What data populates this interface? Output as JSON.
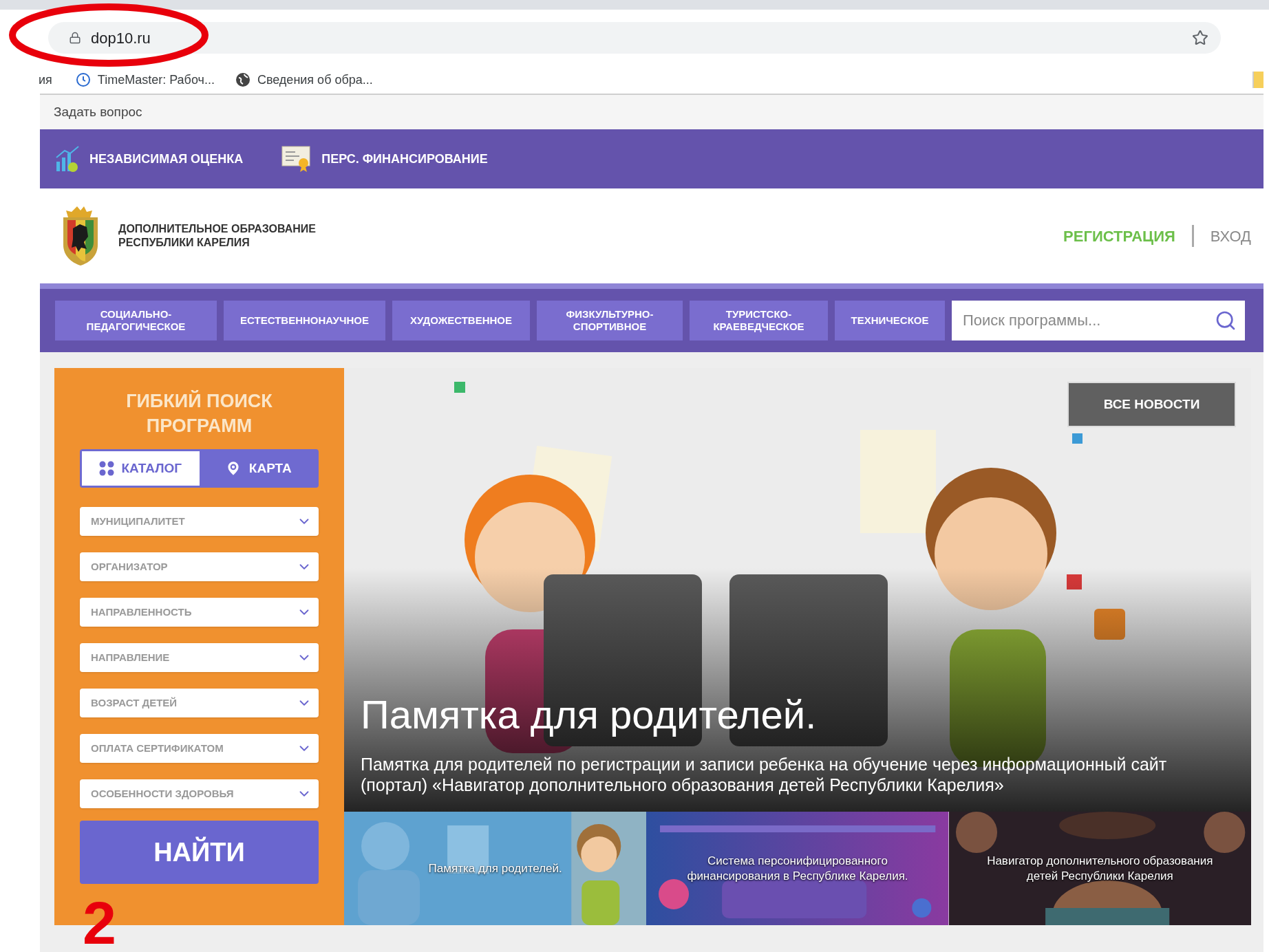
{
  "browser": {
    "address": "dop10.ru",
    "bookmarks": [
      "ия",
      "TimeMaster: Рабоч...",
      "Сведения об обра..."
    ]
  },
  "annotations": [
    {
      "kind": "ellipse"
    },
    {
      "kind": "digit",
      "text": "2"
    }
  ],
  "top_link": "Задать вопрос",
  "promo_bar": [
    "НЕЗАВИСИМАЯ ОЦЕНКА",
    "ПЕРС. ФИНАНСИРОВАНИЕ"
  ],
  "site": {
    "title": "ДОПОЛНИТЕЛЬНОЕ ОБРАЗОВАНИЕ РЕСПУБЛИКИ КАРЕЛИЯ",
    "register": "РЕГИСТРАЦИЯ",
    "login": "ВХОД"
  },
  "nav": [
    "СОЦИАЛЬНО-ПЕДАГОГИЧЕСКОЕ",
    "ЕСТЕСТВЕННОНАУЧНОЕ",
    "ХУДОЖЕСТВЕННОЕ",
    "ФИЗКУЛЬТУРНО-СПОРТИВНОЕ",
    "ТУРИСТСКО-КРАЕВЕДЧЕСКОЕ",
    "ТЕХНИЧЕСКОЕ"
  ],
  "search": {
    "placeholder": "Поиск программы..."
  },
  "sidebar": {
    "title": "ГИБКИЙ ПОИСК ПРОГРАММ",
    "view_tabs": [
      {
        "label": "КАТАЛОГ",
        "selected": true
      },
      {
        "label": "КАРТА",
        "selected": false
      }
    ],
    "filters": [
      "МУНИЦИПАЛИТЕТ",
      "ОРГАНИЗАТОР",
      "НАПРАВЛЕННОСТЬ",
      "НАПРАВЛЕНИЕ",
      "ВОЗРАСТ ДЕТЕЙ",
      "ОПЛАТА СЕРТИФИКАТОМ",
      "ОСОБЕННОСТИ ЗДОРОВЬЯ"
    ],
    "submit": "НАЙТИ"
  },
  "banner": {
    "button": "ВСЕ НОВОСТИ",
    "title": "Памятка для родителей.",
    "text": "Памятка для родителей по регистрации и записи ребенка на обучение через информационный сайт (портал) «Навигатор дополнительного образования детей Республики Карелия»"
  },
  "thumbnails": [
    {
      "caption": "Памятка для родителей."
    },
    {
      "caption": "Система персонифицированного финансирования в Республике Карелия."
    },
    {
      "caption": "Навигатор дополнительного образования детей Республики Карелия"
    }
  ]
}
